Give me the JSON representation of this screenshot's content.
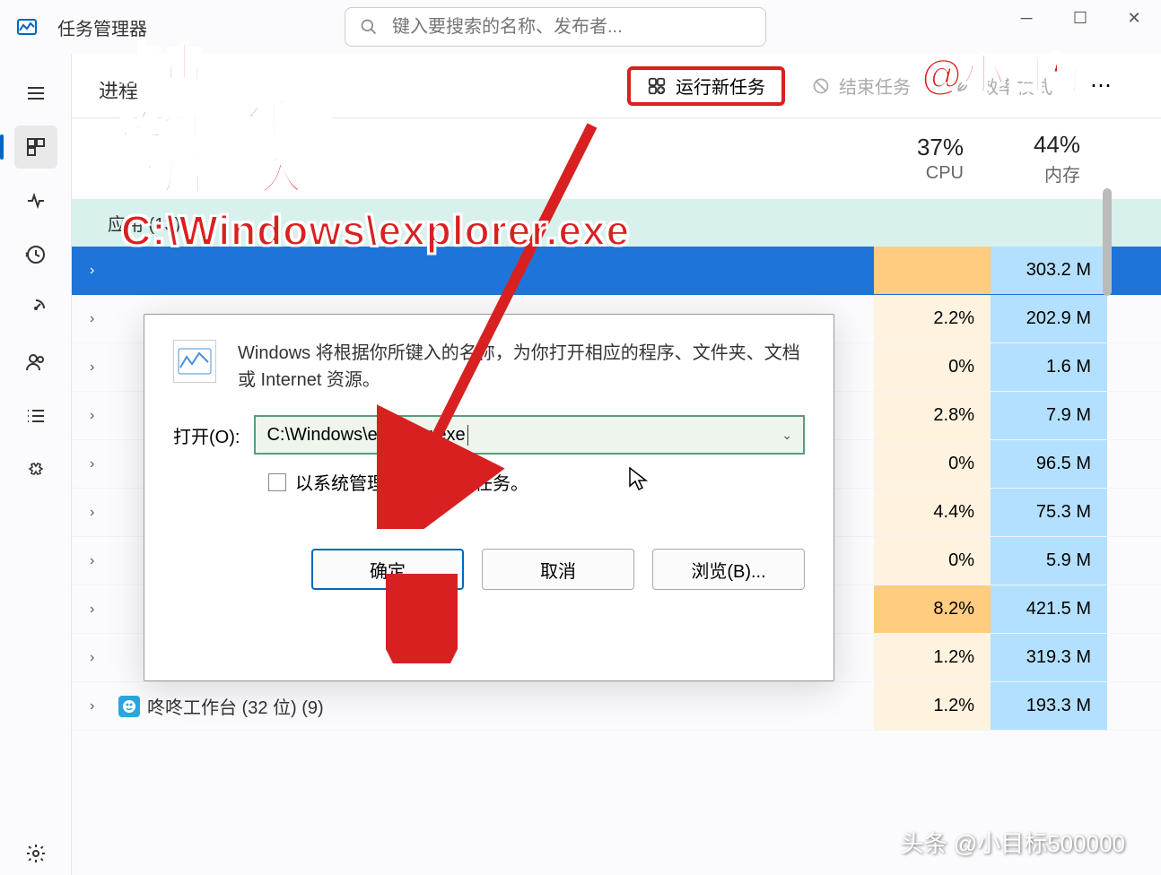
{
  "app": {
    "title": "任务管理器"
  },
  "search": {
    "placeholder": "键入要搜索的名称、发布者..."
  },
  "toolbar": {
    "page_title": "进程",
    "run_task": "运行新任务",
    "end_task": "结束任务",
    "efficiency": "效率模式"
  },
  "columns": {
    "cpu": {
      "pct": "37%",
      "label": "CPU"
    },
    "mem": {
      "pct": "44%",
      "label": "内存"
    }
  },
  "section": {
    "apps": "应用 (13)"
  },
  "rows": [
    {
      "cpu": "",
      "mem": "303.2 M",
      "selected": true
    },
    {
      "cpu": "2.2%",
      "mem": "202.9 M"
    },
    {
      "cpu": "0%",
      "mem": "1.6 M"
    },
    {
      "cpu": "2.8%",
      "mem": "7.9 M"
    },
    {
      "cpu": "0%",
      "mem": "96.5 M"
    },
    {
      "cpu": "4.4%",
      "mem": "75.3 M"
    },
    {
      "cpu": "0%",
      "mem": "5.9 M"
    },
    {
      "cpu": "8.2%",
      "mem": "421.5 M"
    },
    {
      "cpu": "1.2%",
      "mem": "319.3 M"
    },
    {
      "name": "咚咚工作台 (32 位) (9)",
      "cpu": "1.2%",
      "mem": "193.3 M"
    }
  ],
  "dialog": {
    "desc": "Windows 将根据你所键入的名称，为你打开相应的程序、文件夹、文档或 Internet 资源。",
    "open_label": "打开(O):",
    "input_value": "C:\\Windows\\explorer.exe",
    "admin_checkbox": "以系统管理权限创建此任务。",
    "ok": "确定",
    "cancel": "取消",
    "browse": "浏览(B)..."
  },
  "annotations": {
    "main": "点击\n运行新任务\n然后 输入\nC:\\Windows\\explorer.exe",
    "handle": "@小目标",
    "watermark": "头条 @小目标500000"
  }
}
